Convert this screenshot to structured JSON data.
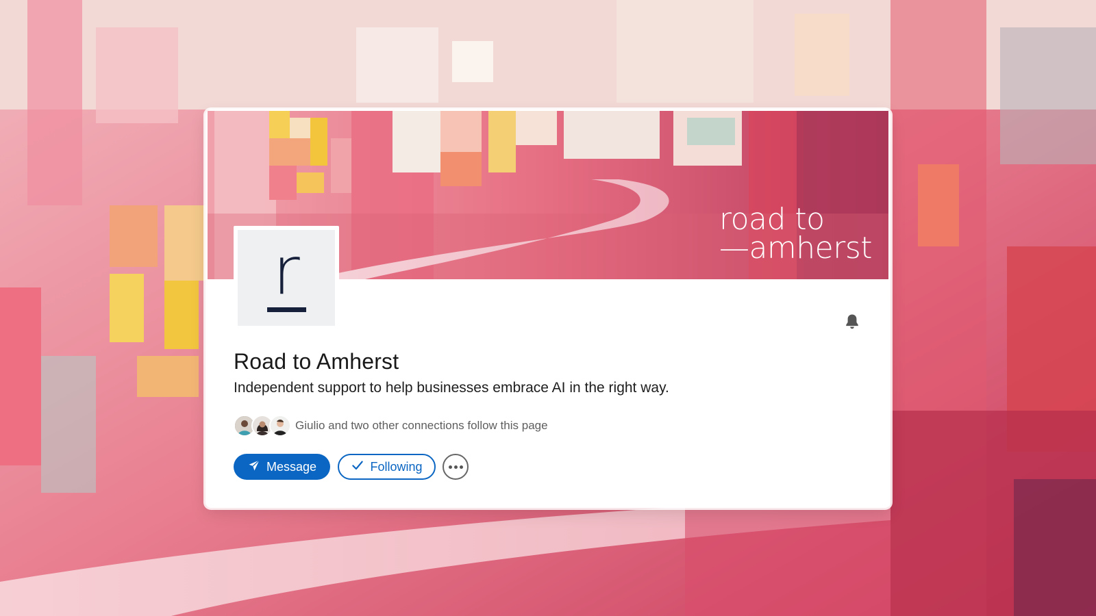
{
  "page": {
    "company_name": "Road to Amherst",
    "tagline": "Independent support to help businesses embrace AI in the right way.",
    "banner_line1": "road to",
    "banner_line2": "—amherst",
    "logo_letter": "r",
    "connections_text": "Giulio and two other connections follow this page"
  },
  "actions": {
    "message_label": "Message",
    "following_label": "Following"
  },
  "icons": {
    "bell": "bell-icon",
    "message": "send-icon",
    "following": "check-icon",
    "more": "more-icon"
  },
  "colors": {
    "accent": "#0a66c2",
    "logo_ink": "#16203a",
    "background": "#e9a3ab"
  }
}
